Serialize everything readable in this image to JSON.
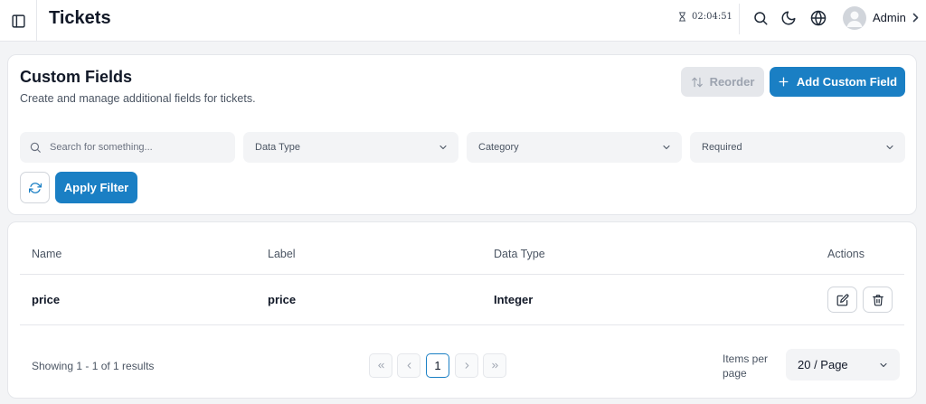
{
  "header": {
    "title": "Tickets",
    "timer": "02:04:51",
    "user_name": "Admin"
  },
  "custom_fields": {
    "title": "Custom Fields",
    "subtitle": "Create and manage additional fields for tickets.",
    "reorder_label": "Reorder",
    "add_label": "Add Custom Field"
  },
  "filters": {
    "search_placeholder": "Search for something...",
    "data_type": "Data Type",
    "category": "Category",
    "required": "Required",
    "apply_label": "Apply Filter"
  },
  "table": {
    "columns": [
      "Name",
      "Label",
      "Data Type",
      "Actions"
    ],
    "rows": [
      {
        "name": "price",
        "label": "price",
        "data_type": "Integer"
      }
    ]
  },
  "pagination": {
    "showing": "Showing 1 - 1 of 1 results",
    "current_page": "1",
    "items_per_page_label": "Items per page",
    "items_per_page": "20 / Page"
  },
  "colors": {
    "primary": "#1a7fc4",
    "disabled": "#e5e7eb"
  }
}
